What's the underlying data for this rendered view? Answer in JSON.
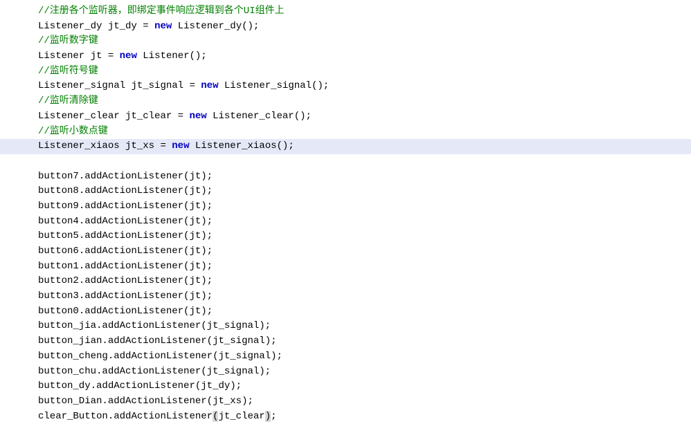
{
  "lines": [
    {
      "type": "comment",
      "text": "//注册各个监听器，即绑定事件响应逻辑到各个UI组件上",
      "highlighted": false
    },
    {
      "type": "decl",
      "className": "Listener_dy",
      "varName": "jt_dy",
      "ctor": "Listener_dy",
      "highlighted": false
    },
    {
      "type": "comment",
      "text": "//监听数字键",
      "highlighted": false
    },
    {
      "type": "decl",
      "className": "Listener",
      "varName": "jt",
      "ctor": "Listener",
      "highlighted": false
    },
    {
      "type": "comment",
      "text": "//监听符号键",
      "highlighted": false
    },
    {
      "type": "decl",
      "className": "Listener_signal",
      "varName": "jt_signal",
      "ctor": "Listener_signal",
      "highlighted": false
    },
    {
      "type": "comment",
      "text": "//监听清除键",
      "highlighted": false
    },
    {
      "type": "decl",
      "className": "Listener_clear",
      "varName": "jt_clear",
      "ctor": "Listener_clear",
      "highlighted": false
    },
    {
      "type": "comment",
      "text": "//监听小数点键",
      "highlighted": false
    },
    {
      "type": "decl",
      "className": "Listener_xiaos",
      "varName": "jt_xs",
      "ctor": "Listener_xiaos",
      "highlighted": true
    },
    {
      "type": "blank",
      "highlighted": false
    },
    {
      "type": "call",
      "obj": "button7",
      "method": "addActionListener",
      "arg": "jt",
      "highlighted": false,
      "parenHighlight": false
    },
    {
      "type": "call",
      "obj": "button8",
      "method": "addActionListener",
      "arg": "jt",
      "highlighted": false,
      "parenHighlight": false
    },
    {
      "type": "call",
      "obj": "button9",
      "method": "addActionListener",
      "arg": "jt",
      "highlighted": false,
      "parenHighlight": false
    },
    {
      "type": "call",
      "obj": "button4",
      "method": "addActionListener",
      "arg": "jt",
      "highlighted": false,
      "parenHighlight": false
    },
    {
      "type": "call",
      "obj": "button5",
      "method": "addActionListener",
      "arg": "jt",
      "highlighted": false,
      "parenHighlight": false
    },
    {
      "type": "call",
      "obj": "button6",
      "method": "addActionListener",
      "arg": "jt",
      "highlighted": false,
      "parenHighlight": false
    },
    {
      "type": "call",
      "obj": "button1",
      "method": "addActionListener",
      "arg": "jt",
      "highlighted": false,
      "parenHighlight": false
    },
    {
      "type": "call",
      "obj": "button2",
      "method": "addActionListener",
      "arg": "jt",
      "highlighted": false,
      "parenHighlight": false
    },
    {
      "type": "call",
      "obj": "button3",
      "method": "addActionListener",
      "arg": "jt",
      "highlighted": false,
      "parenHighlight": false
    },
    {
      "type": "call",
      "obj": "button0",
      "method": "addActionListener",
      "arg": "jt",
      "highlighted": false,
      "parenHighlight": false
    },
    {
      "type": "call",
      "obj": "button_jia",
      "method": "addActionListener",
      "arg": "jt_signal",
      "highlighted": false,
      "parenHighlight": false
    },
    {
      "type": "call",
      "obj": "button_jian",
      "method": "addActionListener",
      "arg": "jt_signal",
      "highlighted": false,
      "parenHighlight": false
    },
    {
      "type": "call",
      "obj": "button_cheng",
      "method": "addActionListener",
      "arg": "jt_signal",
      "highlighted": false,
      "parenHighlight": false
    },
    {
      "type": "call",
      "obj": "button_chu",
      "method": "addActionListener",
      "arg": "jt_signal",
      "highlighted": false,
      "parenHighlight": false
    },
    {
      "type": "call",
      "obj": "button_dy",
      "method": "addActionListener",
      "arg": "jt_dy",
      "highlighted": false,
      "parenHighlight": false
    },
    {
      "type": "call",
      "obj": "button_Dian",
      "method": "addActionListener",
      "arg": "jt_xs",
      "highlighted": false,
      "parenHighlight": false
    },
    {
      "type": "call",
      "obj": "clear_Button",
      "method": "addActionListener",
      "arg": "jt_clear",
      "highlighted": false,
      "parenHighlight": true
    }
  ]
}
